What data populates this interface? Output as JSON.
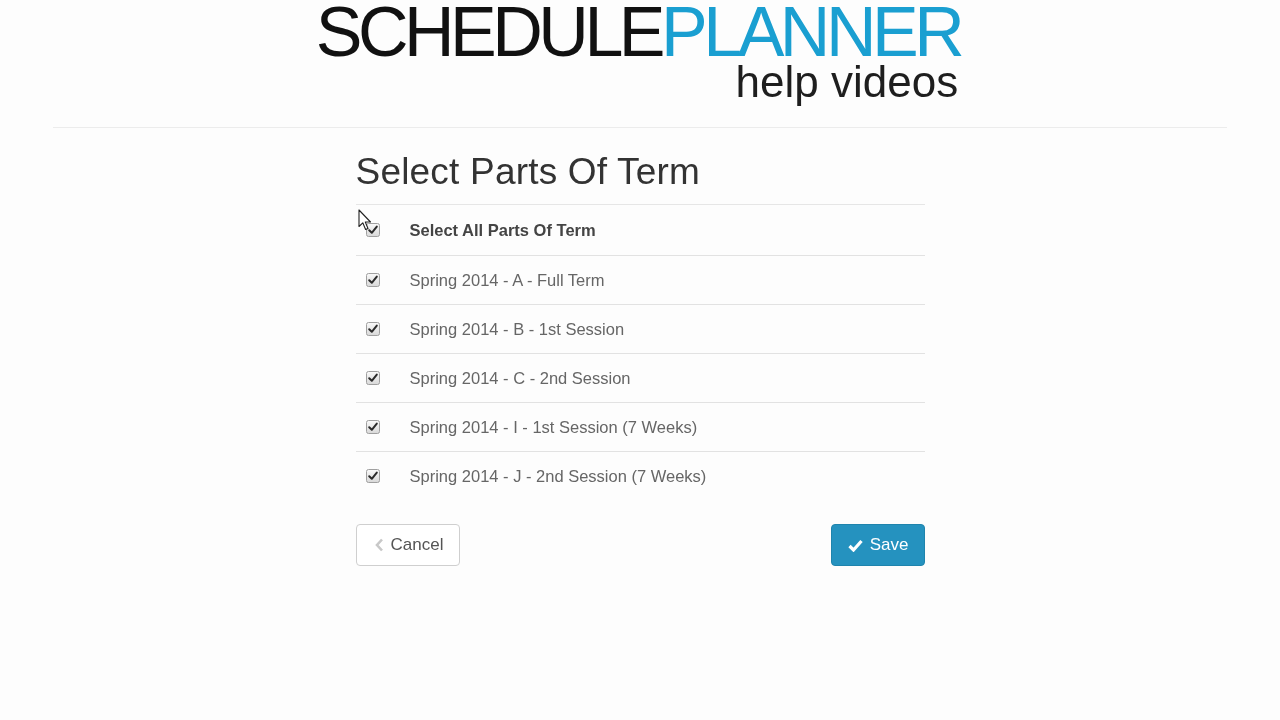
{
  "logo": {
    "words": [
      {
        "text": "SCHEDULE",
        "color": "#111111"
      },
      {
        "text": "PLANNER",
        "color": "#1a9fd1"
      }
    ],
    "tagline": "help videos"
  },
  "heading": "Select Parts Of Term",
  "select_all": {
    "label": "Select All Parts Of Term",
    "checked": true
  },
  "parts": [
    {
      "label": "Spring 2014 - A - Full Term",
      "checked": true
    },
    {
      "label": "Spring 2014 - B - 1st Session",
      "checked": true
    },
    {
      "label": "Spring 2014 - C - 2nd Session",
      "checked": true
    },
    {
      "label": "Spring 2014 - I - 1st Session (7 Weeks)",
      "checked": true
    },
    {
      "label": "Spring 2014 - J - 2nd Session (7 Weeks)",
      "checked": true
    }
  ],
  "buttons": [
    {
      "kind": "cancel",
      "label": "Cancel"
    },
    {
      "kind": "save",
      "label": "Save"
    }
  ]
}
